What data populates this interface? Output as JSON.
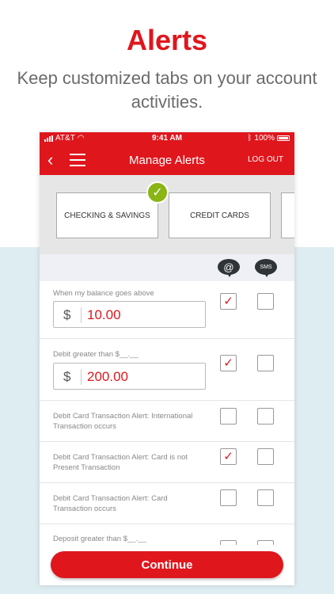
{
  "hero": {
    "title": "Alerts",
    "subtitle": "Keep customized tabs on your account activities."
  },
  "status_bar": {
    "carrier": "AT&T",
    "time": "9:41 AM",
    "battery": "100%"
  },
  "nav": {
    "title": "Manage Alerts",
    "logout_label": "LOG OUT"
  },
  "tabs": [
    {
      "label": "CHECKING & SAVINGS",
      "selected": true
    },
    {
      "label": "CREDIT CARDS",
      "selected": false
    },
    {
      "label": "",
      "selected": false
    }
  ],
  "columns": {
    "email_label": "@",
    "sms_label": "SMS"
  },
  "alerts": [
    {
      "label": "When my balance goes above",
      "currency": "$",
      "value": "10.00",
      "email": true,
      "sms": false
    },
    {
      "label": "Debit greater than $__.__",
      "currency": "$",
      "value": "200.00",
      "email": true,
      "sms": false
    },
    {
      "label": "Debit Card Transaction Alert: International Transaction occurs",
      "email": false,
      "sms": false
    },
    {
      "label": "Debit Card Transaction Alert: Card is not Present Transaction",
      "email": true,
      "sms": false
    },
    {
      "label": "Debit Card Transaction Alert: Card Transaction occurs",
      "email": false,
      "sms": false
    },
    {
      "label": "Deposit greater than $__.__",
      "email": false,
      "sms": false
    }
  ],
  "continue_label": "Continue",
  "check_glyph": "✓",
  "colors": {
    "brand_red": "#e0161d",
    "badge_green": "#8ab515",
    "panel_blue": "#deedf1"
  }
}
